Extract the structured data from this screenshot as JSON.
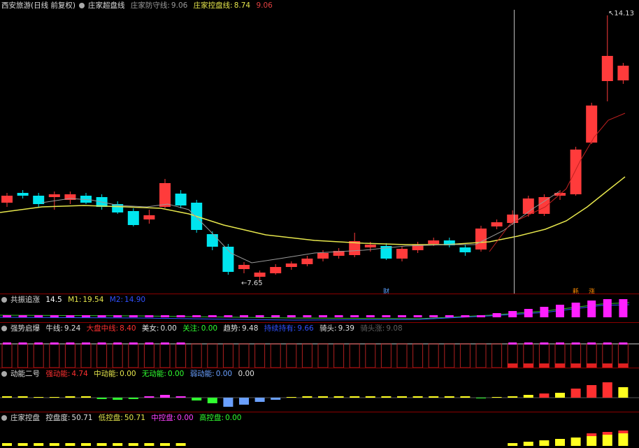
{
  "main": {
    "title": "西安旅游(日线 前复权)",
    "indicator_name": "庄家超盘线",
    "lines": [
      {
        "label": "庄家防守线:",
        "value": "9.06",
        "color": "#9a9a9a"
      },
      {
        "label": "庄家控盘线:",
        "value": "8.74",
        "color": "#e6e64c"
      },
      {
        "label": "",
        "value": "9.06",
        "color": "#e04040"
      }
    ],
    "high_label": "14.13",
    "low_label": "7.65",
    "markers": [
      {
        "text": "财",
        "color": "#5aa0ff"
      },
      {
        "text": "耗",
        "color": "#ff8c00"
      },
      {
        "text": "涨",
        "color": "#ff8c00"
      }
    ]
  },
  "panes": {
    "gongzhen": {
      "name": "共振追涨",
      "items": [
        {
          "label": "",
          "value": "14.5",
          "color": "#ffffff"
        },
        {
          "label": "M1:",
          "value": "19.54",
          "color": "#e6e64c"
        },
        {
          "label": "M2:",
          "value": "14.90",
          "color": "#3050ff"
        }
      ]
    },
    "qiangshi": {
      "name": "强势启爆",
      "items": [
        {
          "label": "牛线:",
          "value": "9.24",
          "color": "#e0e0e0"
        },
        {
          "label": "大盘中线:",
          "value": "8.40",
          "color": "#ff3030"
        },
        {
          "label": "美女:",
          "value": "0.00",
          "color": "#e0e0e0"
        },
        {
          "label": "关注:",
          "value": "0.00",
          "color": "#30ff30"
        },
        {
          "label": "趋势:",
          "value": "9.48",
          "color": "#e0e0e0"
        },
        {
          "label": "持续持有:",
          "value": "9.66",
          "color": "#3050ff"
        },
        {
          "label": "骑头:",
          "value": "9.39",
          "color": "#e0e0e0"
        },
        {
          "label": "骑头涨:",
          "value": "9.08",
          "color": "#606060"
        }
      ]
    },
    "dongneng": {
      "name": "动能二号",
      "items": [
        {
          "label": "强动能:",
          "value": "4.74",
          "color": "#ff3030"
        },
        {
          "label": "中动能:",
          "value": "0.00",
          "color": "#e6e64c"
        },
        {
          "label": "无动能:",
          "value": "0.00",
          "color": "#30ff30"
        },
        {
          "label": "弱动能:",
          "value": "0.00",
          "color": "#6aa0ff"
        },
        {
          "label": "",
          "value": "0.00",
          "color": "#e0e0e0"
        }
      ]
    },
    "kongpan": {
      "name": "庄家控盘",
      "items": [
        {
          "label": "控盘度:",
          "value": "50.71",
          "color": "#e0e0e0"
        },
        {
          "label": "低控盘:",
          "value": "50.71",
          "color": "#e6e64c"
        },
        {
          "label": "中控盘:",
          "value": "0.00",
          "color": "#ff40ff"
        },
        {
          "label": "高控盘:",
          "value": "0.00",
          "color": "#30ff30"
        }
      ]
    }
  },
  "colors": {
    "up": "#ff3b3b",
    "down": "#00e5ee",
    "ma_slow": "#e6e64c",
    "ma_fast": "#9a9a9a",
    "ma_red": "#c02020"
  }
}
